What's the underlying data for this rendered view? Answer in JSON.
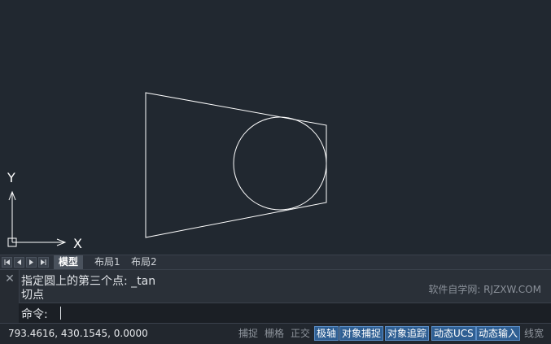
{
  "canvas": {
    "ucs_x_label": "X",
    "ucs_y_label": "Y",
    "line_color": "#ffffff",
    "background_color": "#212830"
  },
  "layout_tabs": {
    "nav_buttons": [
      "first-icon",
      "prev-icon",
      "next-icon",
      "last-icon"
    ],
    "tabs": [
      {
        "label": "模型",
        "active": true
      },
      {
        "label": "布局1",
        "active": false
      },
      {
        "label": "布局2",
        "active": false
      }
    ]
  },
  "command": {
    "history_line_1": "指定圆上的第三个点: _tan",
    "history_line_2": "切点",
    "prompt": "命令:",
    "watermark": "软件自学网: RJZXW.COM"
  },
  "status": {
    "coordinates": "793.4616, 430.1545, 0.0000",
    "buttons": [
      {
        "label": "捕捉",
        "on": false
      },
      {
        "label": "栅格",
        "on": false
      },
      {
        "label": "正交",
        "on": false
      },
      {
        "label": "极轴",
        "on": true
      },
      {
        "label": "对象捕捉",
        "on": true
      },
      {
        "label": "对象追踪",
        "on": true
      },
      {
        "label": "动态UCS",
        "on": true
      },
      {
        "label": "动态输入",
        "on": true
      },
      {
        "label": "线宽",
        "on": false
      }
    ],
    "accent_color": "#2f5f93"
  }
}
